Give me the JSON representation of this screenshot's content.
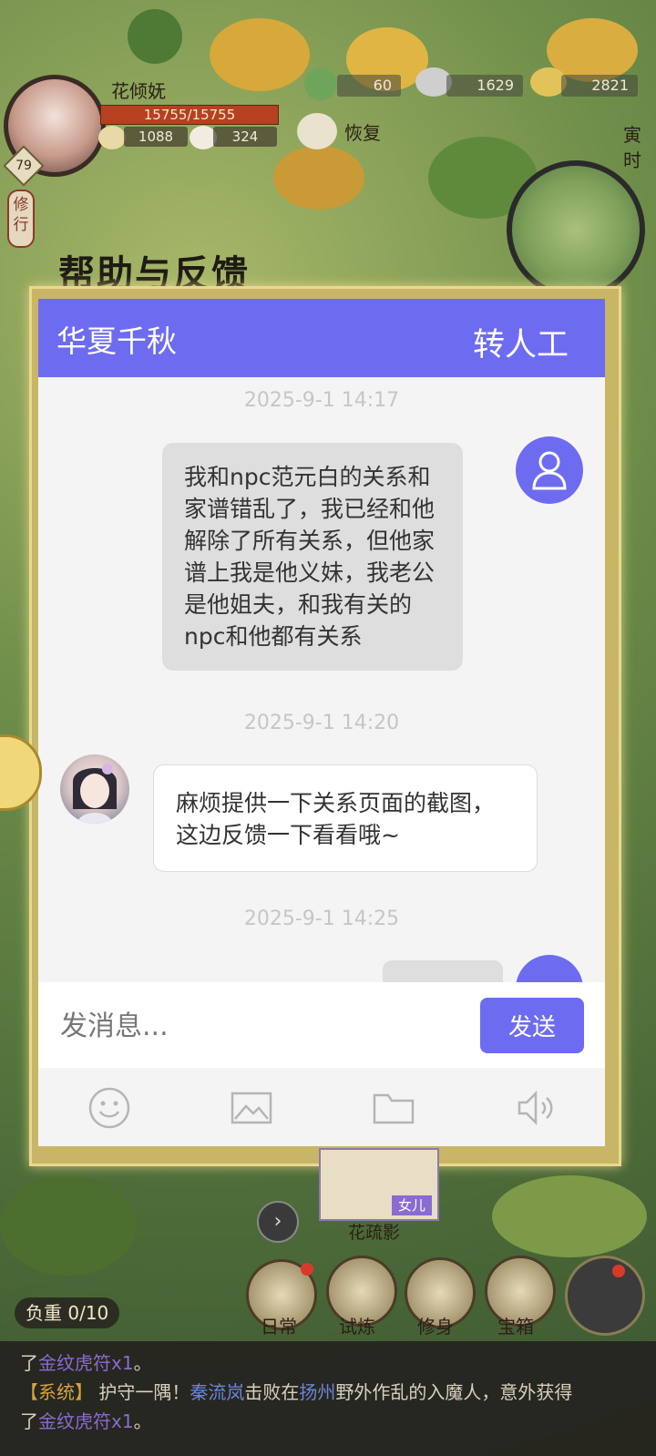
{
  "hud": {
    "player_name": "花倾妩",
    "level": "79",
    "hp": "15755/15755",
    "food": "1088",
    "bun": "324",
    "recover_label": "恢复",
    "currencies": {
      "jade": "60",
      "silver": "1629",
      "gold": "2821"
    },
    "time_label": "寅时",
    "practice_label": "修行"
  },
  "dialog": {
    "title": "帮助与反馈",
    "header": {
      "game_name": "华夏千秋",
      "human_agent_label": "转人工"
    },
    "messages": [
      {
        "timestamp": "2025-9-1 14:17",
        "sender": "user",
        "text": "我和npc范元白的关系和家谱错乱了，我已经和他解除了所有关系，但他家谱上我是他义妹，我老公是他姐夫，和我有关的npc和他都有关系"
      },
      {
        "timestamp": "2025-9-1 14:20",
        "sender": "support",
        "text": "麻烦提供一下关系页面的截图，这边反馈一下看看哦~"
      },
      {
        "timestamp": "2025-9-1 14:25",
        "sender": "user",
        "text": ""
      }
    ],
    "input": {
      "placeholder": "发消息...",
      "value": ""
    },
    "send_label": "发送",
    "toolbar_icons": [
      "emoji-icon",
      "image-icon",
      "folder-icon",
      "voice-icon"
    ]
  },
  "bottom": {
    "daughter_tag": "女儿",
    "daughter_name": "花疏影",
    "weight_label": "负重 0/10",
    "nav": [
      "日常",
      "试炼",
      "修身",
      "宝箱"
    ]
  },
  "feed": {
    "line1_prefix": "了",
    "line1_item": "金纹虎符x1",
    "line1_suffix": "。",
    "line2_sys": "【系统】",
    "line2_a": "护守一隅！",
    "line2_name": "秦流岚",
    "line2_b": "击败在",
    "line2_place": "扬州",
    "line2_c": "野外作乱的入魔人，意外获得",
    "line3_prefix": "了",
    "line3_item": "金纹虎符x1",
    "line3_suffix": "。"
  },
  "colors": {
    "accent": "#6d6cf0",
    "user_bubble": "#dedede",
    "support_bubble": "#ffffff"
  }
}
